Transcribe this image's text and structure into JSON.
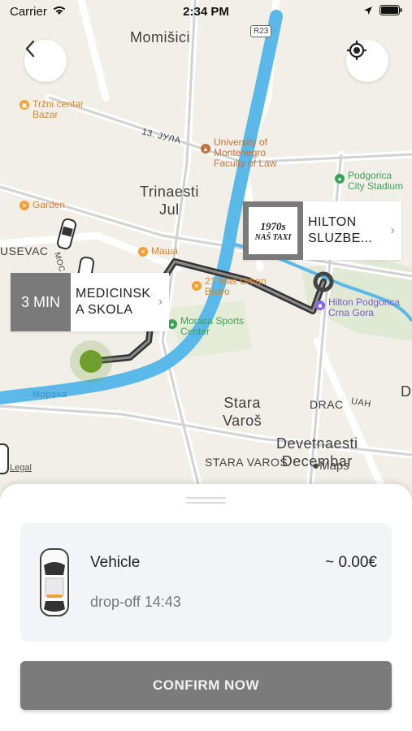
{
  "status": {
    "carrier": "Carrier",
    "time": "2:34 PM"
  },
  "map": {
    "labels": {
      "momisici": "Momišici",
      "road": "R23",
      "trinaesti1": "Trinaesti",
      "trinaesti2": "Jul",
      "street_13jula": "13. ЈУЛА",
      "usevac": "USEVAC",
      "stara1": "Stara",
      "stara2": "Varoš",
      "drac": "DRAC",
      "devetnaesti1": "Devetnaesti",
      "devetnaesti2": "Decembar",
      "stara_varos": "STARA VAROS",
      "moraca": "Морача",
      "uah": "UAH",
      "d": "D",
      "mos": "МОС"
    },
    "pois": {
      "trzni1": "Tržni centar",
      "trzni2": "Bazar",
      "university1": "University of",
      "university2": "Montenegro",
      "university3": "Faculty of Law",
      "stadium1": "Podgorica",
      "stadium2": "City Stadium",
      "garden": "Garden",
      "masha": "Маша",
      "bistro1": "21 Маѕ Urban",
      "bistro2": "Bistro",
      "hilton1": "Hilton Podgorica",
      "hilton2": "Crna Gora",
      "sports1": "Moraca Sports",
      "sports2": "Center"
    },
    "legal": "Legal",
    "maps_logo": "Maps"
  },
  "callouts": {
    "pickup": {
      "badge": "3 MIN",
      "line1": "MEDICINSK",
      "line2": "A SKOLA",
      "chevron": "›"
    },
    "destination": {
      "logo_text1": "1970s",
      "logo_text2": "NAŠ TAXI",
      "line1": "HILTON",
      "line2": "SLUZBE...",
      "chevron": "›"
    }
  },
  "sheet": {
    "vehicle_name": "Vehicle",
    "price": "~ 0.00€",
    "dropoff": "drop-off 14:43",
    "confirm_label": "CONFIRM NOW"
  },
  "colors": {
    "accent_gray": "#7b7b7b",
    "river": "#5ab9e8",
    "route": "#333333",
    "pickup_dot": "#6e9e2c"
  }
}
